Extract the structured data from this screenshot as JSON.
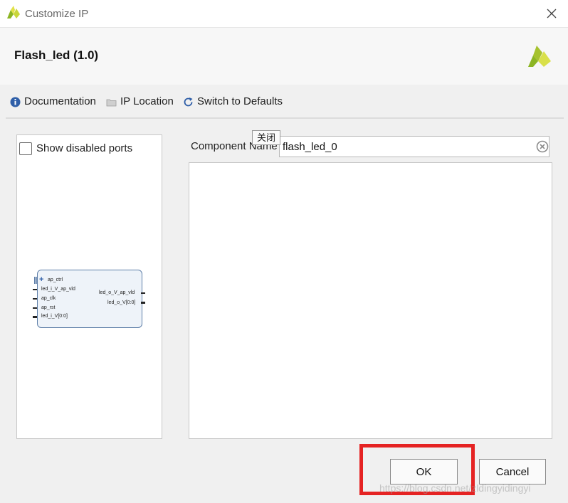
{
  "window": {
    "title": "Customize IP",
    "logo_icon": "xilinx-logo-icon",
    "close_icon": "close-icon"
  },
  "header": {
    "ip_title": "Flash_led (1.0)",
    "brand_icon": "xilinx-logo-icon"
  },
  "toolbar": {
    "documentation_label": "Documentation",
    "ip_location_label": "IP Location",
    "switch_defaults_label": "Switch to Defaults"
  },
  "left_panel": {
    "show_disabled_ports_label": "Show disabled ports",
    "show_disabled_ports_checked": false,
    "block": {
      "left_ports": [
        "ap_ctrl",
        "led_i_V_ap_vld",
        "ap_clk",
        "ap_rst",
        "led_i_V[0:0]"
      ],
      "right_ports": [
        "led_o_V_ap_vld",
        "led_o_V[0:0]"
      ]
    }
  },
  "component": {
    "label": "Component Name",
    "value": "flash_led_0"
  },
  "tooltip": {
    "text": "关闭"
  },
  "buttons": {
    "ok_label": "OK",
    "cancel_label": "Cancel"
  },
  "watermark": {
    "text": "https://blog.csdn.net/zldingyidingyi"
  },
  "colors": {
    "highlight": "#e52323",
    "block_border": "#5d7ea8",
    "brand_green": "#8cb523",
    "brand_yellow": "#e8e84a"
  }
}
